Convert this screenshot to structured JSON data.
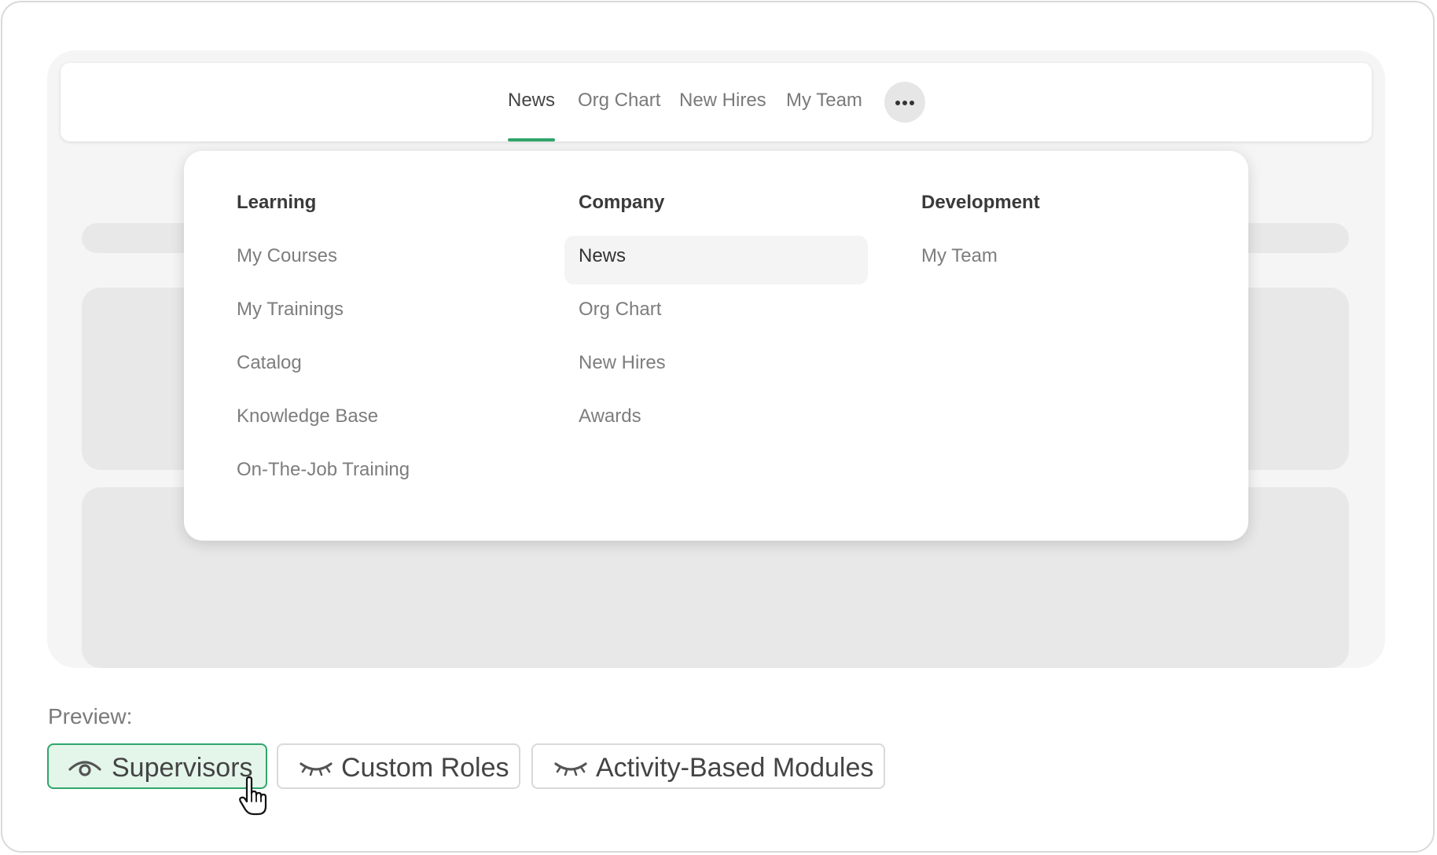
{
  "colors": {
    "accent": "#2fa56a",
    "active_button_bg": "#e4f5ea",
    "active_button_border": "#2fa56a"
  },
  "top_nav": {
    "items": [
      {
        "label": "News",
        "active": true
      },
      {
        "label": "Org Chart",
        "active": false
      },
      {
        "label": "New Hires",
        "active": false
      },
      {
        "label": "My Team",
        "active": false
      }
    ],
    "more_icon": "ellipsis-icon"
  },
  "dropdown": {
    "columns": [
      {
        "heading": "Learning",
        "items": [
          "My Courses",
          "My Trainings",
          "Catalog",
          "Knowledge Base",
          "On-The-Job Training"
        ]
      },
      {
        "heading": "Company",
        "items": [
          "News",
          "Org Chart",
          "New Hires",
          "Awards"
        ],
        "highlighted": "News"
      },
      {
        "heading": "Development",
        "items": [
          "My Team"
        ]
      }
    ]
  },
  "preview": {
    "label": "Preview:",
    "buttons": [
      {
        "label": "Supervisors",
        "icon": "eye-open-icon",
        "active": true
      },
      {
        "label": "Custom Roles",
        "icon": "eye-closed-icon",
        "active": false
      },
      {
        "label": "Activity-Based Modules",
        "icon": "eye-closed-icon",
        "active": false
      }
    ]
  }
}
